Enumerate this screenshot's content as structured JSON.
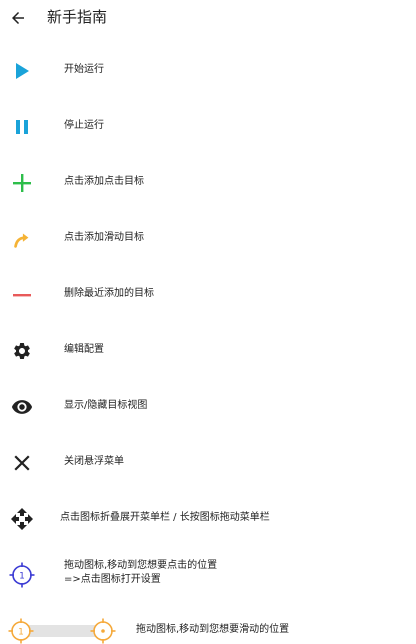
{
  "header": {
    "title": "新手指南",
    "back_icon": "arrow-left-icon"
  },
  "items": [
    {
      "icon": "play-icon",
      "color": "#1AA3D9",
      "label": "开始运行"
    },
    {
      "icon": "pause-icon",
      "color": "#1AA3D9",
      "label": "停止运行"
    },
    {
      "icon": "plus-icon",
      "color": "#2DBE4A",
      "label": "点击添加点击目标"
    },
    {
      "icon": "swipe-arrow-icon",
      "color": "#F5B335",
      "label": "点击添加滑动目标"
    },
    {
      "icon": "minus-icon",
      "color": "#E85A5A",
      "label": "删除最近添加的目标"
    },
    {
      "icon": "gear-icon",
      "color": "#222222",
      "label": "编辑配置"
    },
    {
      "icon": "eye-icon",
      "color": "#222222",
      "label": "显示/隐藏目标视图"
    },
    {
      "icon": "close-icon",
      "color": "#222222",
      "label": "关闭悬浮菜单"
    },
    {
      "icon": "move-icon",
      "color": "#222222",
      "label": "点击图标折叠展开菜单栏 / 长按图标拖动菜单栏"
    },
    {
      "icon": "click-target-icon",
      "color": "#3B3BD4",
      "badge": "1",
      "label_line1": "拖动图标,移动到您想要点击的位置",
      "label_line2": "=>点击图标打开设置"
    }
  ],
  "swipe_target": {
    "start_icon": "swipe-start-target-icon",
    "end_icon": "swipe-end-target-icon",
    "color": "#F5A93A",
    "badge": "1",
    "label": "拖动图标,移动到您想要滑动的位置"
  }
}
